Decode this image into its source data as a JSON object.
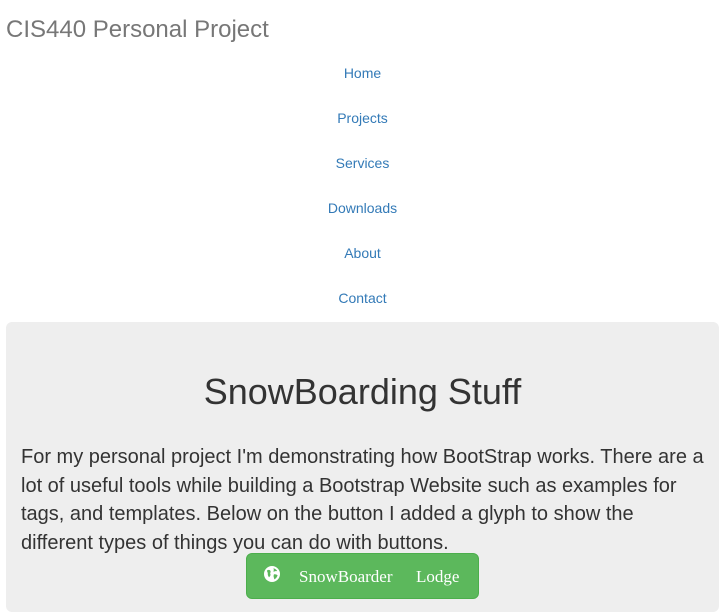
{
  "navbar": {
    "brand": "CIS440 Personal Project",
    "items": [
      {
        "label": "Home"
      },
      {
        "label": "Projects"
      },
      {
        "label": "Services"
      },
      {
        "label": "Downloads"
      },
      {
        "label": "About"
      },
      {
        "label": "Contact"
      }
    ]
  },
  "jumbotron": {
    "title": "SnowBoarding Stuff",
    "text": "For my personal project I'm demonstrating how BootStrap works. There are a lot of useful tools while building a Bootstrap Website such as examples for tags, and templates. Below on the button I added a glyph to show the different types of things you can do with buttons.",
    "button": {
      "icon": "globe-icon",
      "label_part1": "SnowBoarder",
      "label_part2": "Lodge",
      "color": "#5cb85c"
    }
  },
  "colors": {
    "brand_text": "#777777",
    "link": "#337ab7",
    "jumbotron_bg": "#eeeeee",
    "body_text": "#333333"
  }
}
